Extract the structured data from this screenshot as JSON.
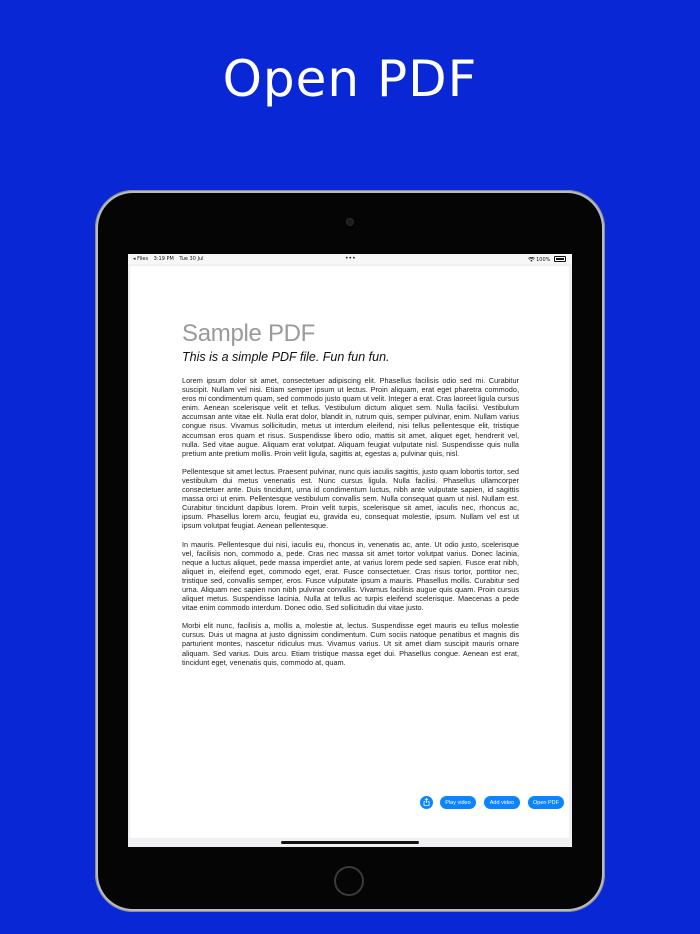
{
  "headline": "Open PDF",
  "statusbar": {
    "back_app": "◂ Files",
    "time": "3:19 PM",
    "date": "Tue 30 Jul",
    "dots": "•••",
    "wifi_icon": "wifi-icon",
    "battery": "100%"
  },
  "document": {
    "title": "Sample PDF",
    "subtitle": "This is a simple PDF file. Fun fun fun.",
    "paragraphs": [
      "Lorem ipsum dolor sit amet, consectetuer adipiscing elit. Phasellus facilisis odio sed mi. Curabitur suscipit. Nullam vel nisi. Etiam semper ipsum ut lectus. Proin aliquam, erat eget pharetra commodo, eros mi condimentum quam, sed commodo justo quam ut velit. Integer a erat. Cras laoreet ligula cursus enim. Aenean scelerisque velit et tellus. Vestibulum dictum aliquet sem. Nulla facilisi. Vestibulum accumsan ante vitae elit. Nulla erat dolor, blandit in, rutrum quis, semper pulvinar, enim. Nullam varius congue risus. Vivamus sollicitudin, metus ut interdum eleifend, nisi tellus pellentesque elit, tristique accumsan eros quam et risus. Suspendisse libero odio, mattis sit amet, aliquet eget, hendrerit vel, nulla. Sed vitae augue. Aliquam erat volutpat. Aliquam feugiat vulputate nisl. Suspendisse quis nulla pretium ante pretium mollis. Proin velit ligula, sagittis at, egestas a, pulvinar quis, nisl.",
      "Pellentesque sit amet lectus. Praesent pulvinar, nunc quis iaculis sagittis, justo quam lobortis tortor, sed vestibulum dui metus venenatis est. Nunc cursus ligula. Nulla facilisi. Phasellus ullamcorper consectetuer ante. Duis tincidunt, urna id condimentum luctus, nibh ante vulputate sapien, id sagittis massa orci ut enim. Pellentesque vestibulum convallis sem. Nulla consequat quam ut nisl. Nullam est. Curabitur tincidunt dapibus lorem. Proin velit turpis, scelerisque sit amet, iaculis nec, rhoncus ac, ipsum. Phasellus lorem arcu, feugiat eu, gravida eu, consequat molestie, ipsum. Nullam vel est ut ipsum volutpat feugiat. Aenean pellentesque.",
      "In mauris. Pellentesque dui nisi, iaculis eu, rhoncus in, venenatis ac, ante. Ut odio justo, scelerisque vel, facilisis non, commodo a, pede. Cras nec massa sit amet tortor volutpat varius. Donec lacinia, neque a luctus aliquet, pede massa imperdiet ante, at varius lorem pede sed sapien. Fusce erat nibh, aliquet in, eleifend eget, commodo eget, erat. Fusce consectetuer. Cras risus tortor, porttitor nec, tristique sed, convallis semper, eros. Fusce vulputate ipsum a mauris. Phasellus mollis. Curabitur sed urna. Aliquam nec sapien non nibh pulvinar convallis. Vivamus facilisis augue quis quam. Proin cursus aliquet metus. Suspendisse lacinia. Nulla at tellus ac turpis eleifend scelerisque. Maecenas a pede vitae enim commodo interdum. Donec odio. Sed sollicitudin dui vitae justo.",
      "Morbi elit nunc, facilisis a, mollis a, molestie at, lectus. Suspendisse eget mauris eu tellus molestie cursus. Duis ut magna at justo dignissim condimentum. Cum sociis natoque penatibus et magnis dis parturient montes, nascetur ridiculus mus. Vivamus varius. Ut sit amet diam suscipit mauris ornare aliquam. Sed varius. Duis arcu. Etiam tristique massa eget dui. Phasellus congue. Aenean est erat, tincidunt eget, venenatis quis, commodo at, quam."
    ]
  },
  "toolbar": {
    "share_icon": "share-icon",
    "play_video": "Play video",
    "add_video": "Add video",
    "open_pdf": "Open PDF"
  },
  "colors": {
    "background": "#0a27d6",
    "button": "#0a84ff"
  }
}
